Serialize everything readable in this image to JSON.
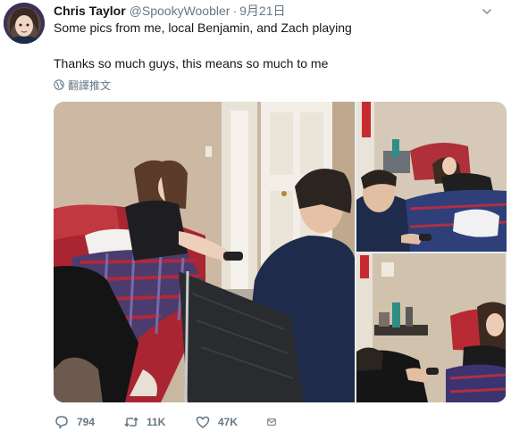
{
  "tweet": {
    "author": {
      "display_name": "Chris Taylor",
      "handle": "@SpookyWoobler"
    },
    "separator": "·",
    "timestamp": "9月21日",
    "text_lines": [
      "Some pics from me, local Benjamin, and Zach playing",
      "Thanks so much guys, this means so much to me"
    ],
    "translate_label": "翻譯推文",
    "actions": {
      "replies": "794",
      "retweets": "11K",
      "likes": "47K"
    },
    "photos": [
      "photo-main",
      "photo-top-right",
      "photo-bottom-right"
    ],
    "icons": {
      "reply": "comment-icon",
      "retweet": "retweet-icon",
      "like": "heart-icon",
      "dm": "envelope-icon",
      "translate": "globe-icon",
      "menu": "chevron-down-icon"
    },
    "colors": {
      "text_primary": "#14171a",
      "text_secondary": "#657786",
      "background": "#ffffff"
    }
  }
}
